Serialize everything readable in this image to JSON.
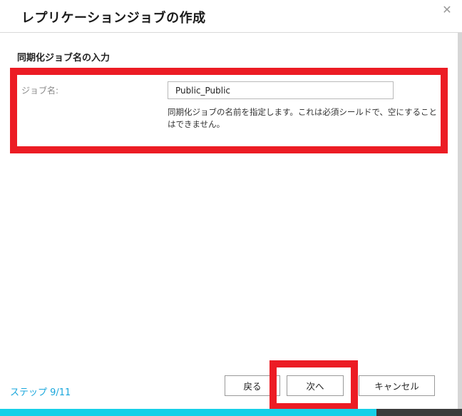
{
  "dialog": {
    "title": "レプリケーションジョブの作成",
    "close_symbol": "✕"
  },
  "section": {
    "title": "同期化ジョブ名の入力"
  },
  "job_name": {
    "label": "ジョブ名:",
    "value": "Public_Public",
    "help": "同期化ジョブの名前を指定します。これは必須シールドで、空にすることはできません。"
  },
  "footer": {
    "step": "ステップ 9/11",
    "back_label": "戻る",
    "next_label": "次へ",
    "cancel_label": "キャンセル"
  },
  "progress": {
    "fraction": 0.815,
    "fill_color": "#16d0e8"
  },
  "colors": {
    "highlight": "#ec1c24",
    "accent": "#1aa7dc"
  },
  "icons": {
    "close": "close-icon"
  }
}
